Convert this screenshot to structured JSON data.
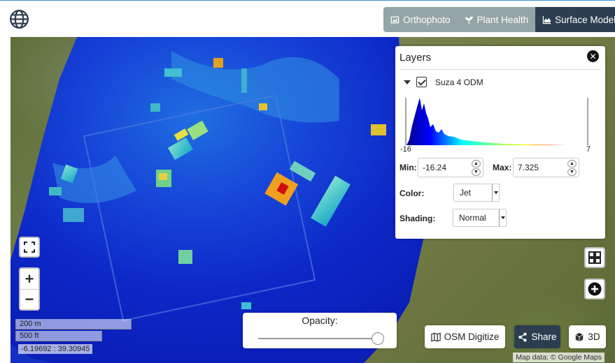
{
  "tabs": [
    {
      "label": "Orthophoto",
      "icon": "image-icon",
      "active": false
    },
    {
      "label": "Plant Health",
      "icon": "plant-icon",
      "active": false
    },
    {
      "label": "Surface Model",
      "icon": "area-chart-icon",
      "active": true
    }
  ],
  "layers_panel": {
    "title": "Layers",
    "layer_name": "Suza 4 ODM",
    "checked": true,
    "histogram": {
      "min_label": "-16",
      "max_label": "7"
    },
    "min_label": "Min:",
    "min_value": "-16.24",
    "max_label": "Max:",
    "max_value": "7.325",
    "color_label": "Color:",
    "color_value": "Jet",
    "shading_label": "Shading:",
    "shading_value": "Normal"
  },
  "scale": {
    "metric": "200 m",
    "imperial": "500 ft"
  },
  "coordinates": "-6.19692 : 39.30945",
  "opacity": {
    "label": "Opacity:",
    "value": 1.0
  },
  "buttons": {
    "osm": "OSM Digitize",
    "share": "Share",
    "three_d": "3D"
  },
  "attribution": "Map data: © Google Maps",
  "colors": {
    "active_tab": "#2c3e50",
    "inactive_tab": "#95a5a6",
    "dem_low": "#0a1fc8",
    "dem_high": "#ff3a00"
  }
}
